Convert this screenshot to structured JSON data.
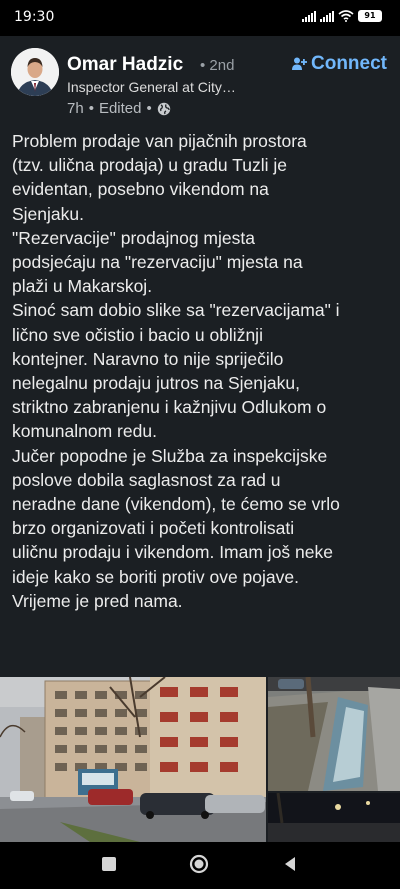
{
  "status_bar": {
    "time": "19:30",
    "battery": "91"
  },
  "post": {
    "author": {
      "name": "Omar Hadzic",
      "degree": "2nd",
      "headline": "Inspector General at City…"
    },
    "meta": {
      "time_ago": "7h",
      "edited": "Edited"
    },
    "connect_label": "Connect",
    "text_lines": [
      "Problem prodaje van pijačnih prostora",
      "(tzv. ulična prodaja) u gradu Tuzli je",
      "evidentan, posebno vikendom na",
      "Sjenjaku.",
      "\"Rezervacije\" prodajnog mjesta",
      "podsjećaju na \"rezervaciju\" mjesta na",
      "plaži u Makarskoj.",
      "Sinoć sam dobio slike sa \"rezervacijama\" i",
      "lično sve očistio i bacio u obližnji",
      "kontejner. Naravno to nije spriječilo",
      "nelegalnu prodaju jutros na Sjenjaku,",
      "striktno zabranjenu i kažnjivu Odlukom o",
      "komunalnom redu.",
      "Jučer popodne je Služba za inspekcijske",
      "poslove dobila saglasnost za rad u",
      "neradne dane (vikendom), te ćemo se vrlo",
      "brzo organizovati i početi kontrolisati",
      "uličnu prodaju i vikendom. Imam još neke",
      "ideje kako se boriti protiv ove pojave.",
      "Vrijeme je pred nama."
    ]
  },
  "icons": {
    "connect": "add-person-icon",
    "visibility": "globe-icon",
    "nav_recents": "square-icon",
    "nav_home": "circle-icon",
    "nav_back": "triangle-back-icon"
  },
  "colors": {
    "card_background": "#1b1f23",
    "connect_accent": "#71b7fb",
    "text": "#ececec"
  }
}
